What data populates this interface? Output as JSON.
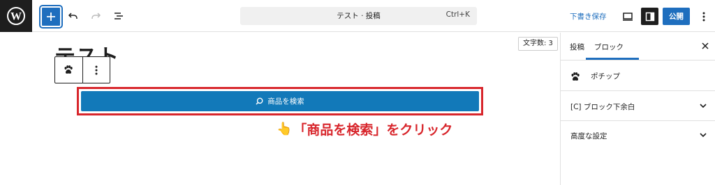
{
  "toolbar": {
    "command_title": "テスト · 投稿",
    "command_shortcut": "Ctrl+K",
    "save_draft_label": "下書き保存",
    "publish_label": "公開"
  },
  "editor": {
    "word_count": "文字数: 3",
    "post_title": "テスト",
    "search_button_label": "商品を検索",
    "annotation_text": "「商品を検索」をクリック"
  },
  "sidebar": {
    "tabs": [
      {
        "label": "投稿"
      },
      {
        "label": "ブロック"
      }
    ],
    "block_name": "ポチップ",
    "panels": [
      {
        "title": "[C] ブロック下余白"
      },
      {
        "title": "高度な設定"
      }
    ]
  },
  "colors": {
    "accent": "#1e6ebe",
    "button": "#1279b9",
    "highlight": "#d8262c"
  },
  "icons": {
    "logo": "wordpress-icon",
    "block": "paw-icon",
    "pointer": "pointing-hand-icon"
  }
}
